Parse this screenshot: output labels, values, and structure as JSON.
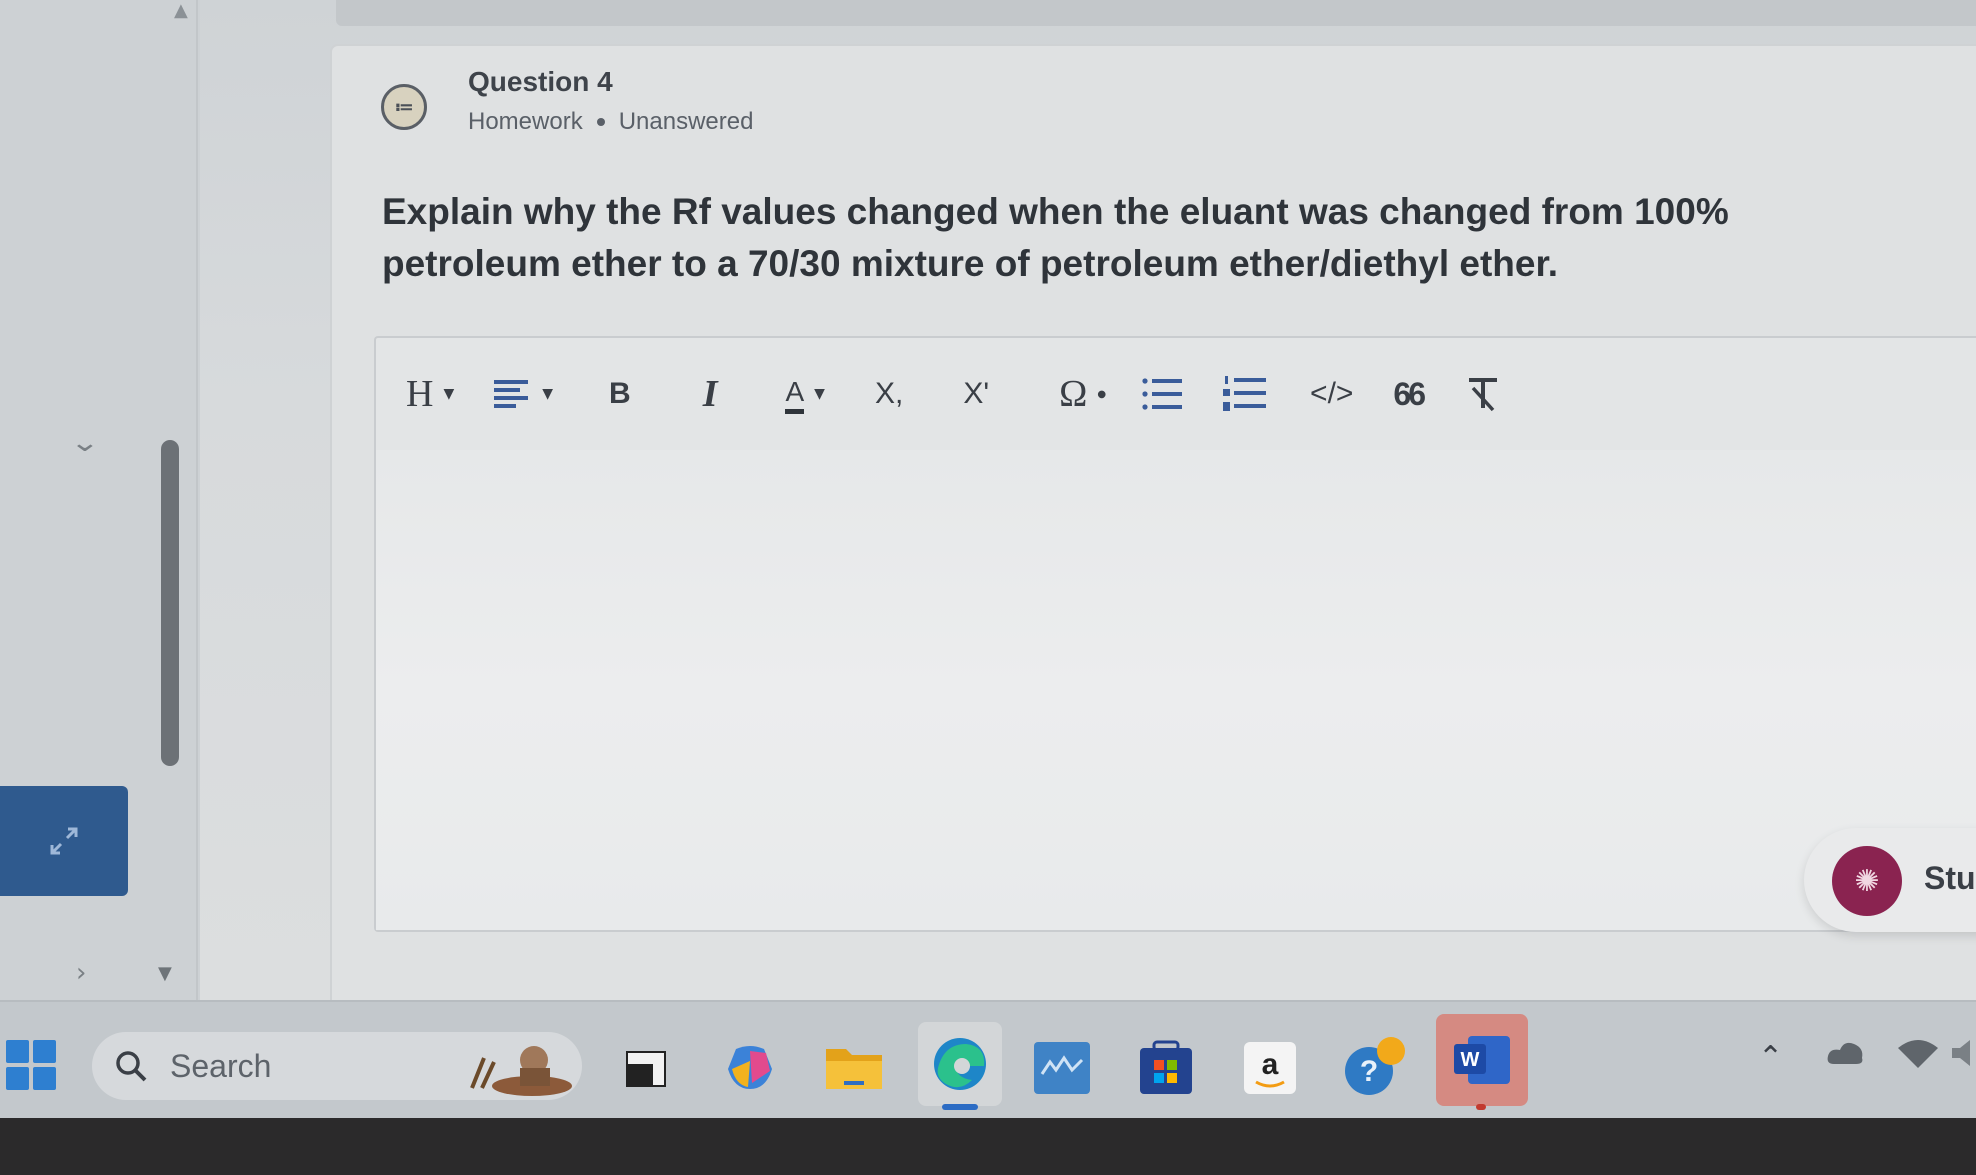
{
  "question": {
    "title": "Question 4",
    "category": "Homework",
    "status": "Unanswered",
    "prompt": "Explain why the Rf values changed when the eluant was changed from 100% petroleum ether to a 70/30 mixture of petroleum ether/diethyl ether."
  },
  "editor": {
    "toolbar": {
      "heading": "H",
      "bold": "B",
      "italic": "I",
      "font_color": "A",
      "subscript": "X,",
      "superscript": "X'",
      "special_char": "Ω",
      "code": "</>",
      "blockquote": "66"
    },
    "answer_value": ""
  },
  "study_helper": {
    "label": "Stu"
  },
  "taskbar": {
    "search_placeholder": "Search",
    "apps": [
      "task-view",
      "copilot",
      "file-explorer",
      "edge",
      "mcgraw-hill",
      "microsoft-store",
      "amazon",
      "help",
      "word"
    ]
  },
  "colors": {
    "accent": "#2f5a8e",
    "study_icon": "#8a2350",
    "word_app": "#c23a2f",
    "edge_blue": "#1e86c8"
  }
}
